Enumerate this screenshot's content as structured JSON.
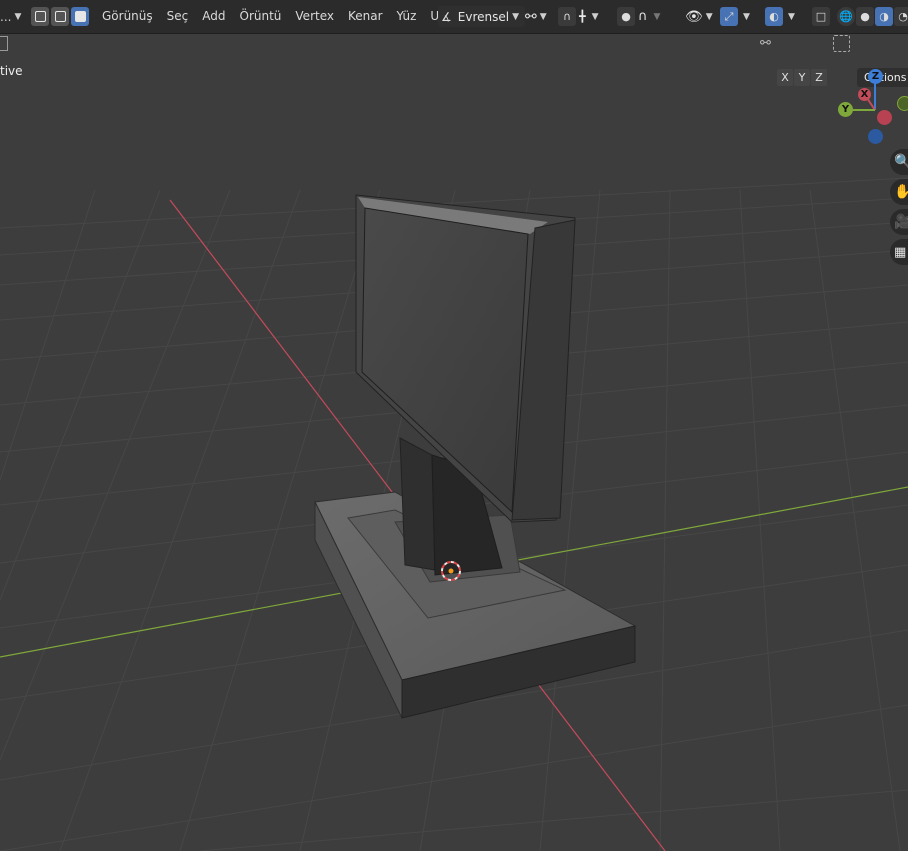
{
  "header": {
    "menu": [
      "Görünüş",
      "Seç",
      "Add",
      "Örüntü",
      "Vertex",
      "Kenar",
      "Yüz",
      "UV"
    ],
    "transform_orientation": "Evrensel",
    "mode_dropdown_label": "..."
  },
  "viewport": {
    "mode_text": "tive",
    "axis_buttons": [
      "X",
      "Y",
      "Z"
    ],
    "options_label": "Options",
    "gizmo_axes": {
      "z": "Z",
      "x": "X",
      "y": "Y"
    }
  },
  "colors": {
    "accent": "#4772b3",
    "grid_bg": "#3d3d3d",
    "x_axis": "#c44b5a",
    "y_axis": "#7fa83a",
    "z_axis": "#3c7dd8"
  },
  "icons": [
    "select-box-icon",
    "eye-icon",
    "gizmo-icon",
    "overlay-icon",
    "xray-icon",
    "wireframe-shading-icon",
    "solid-shading-icon",
    "material-shading-icon",
    "render-shading-icon",
    "zoom-icon",
    "hand-icon",
    "camera-icon",
    "grid-icon",
    "snap-icon",
    "proportional-icon",
    "falloff-icon"
  ]
}
